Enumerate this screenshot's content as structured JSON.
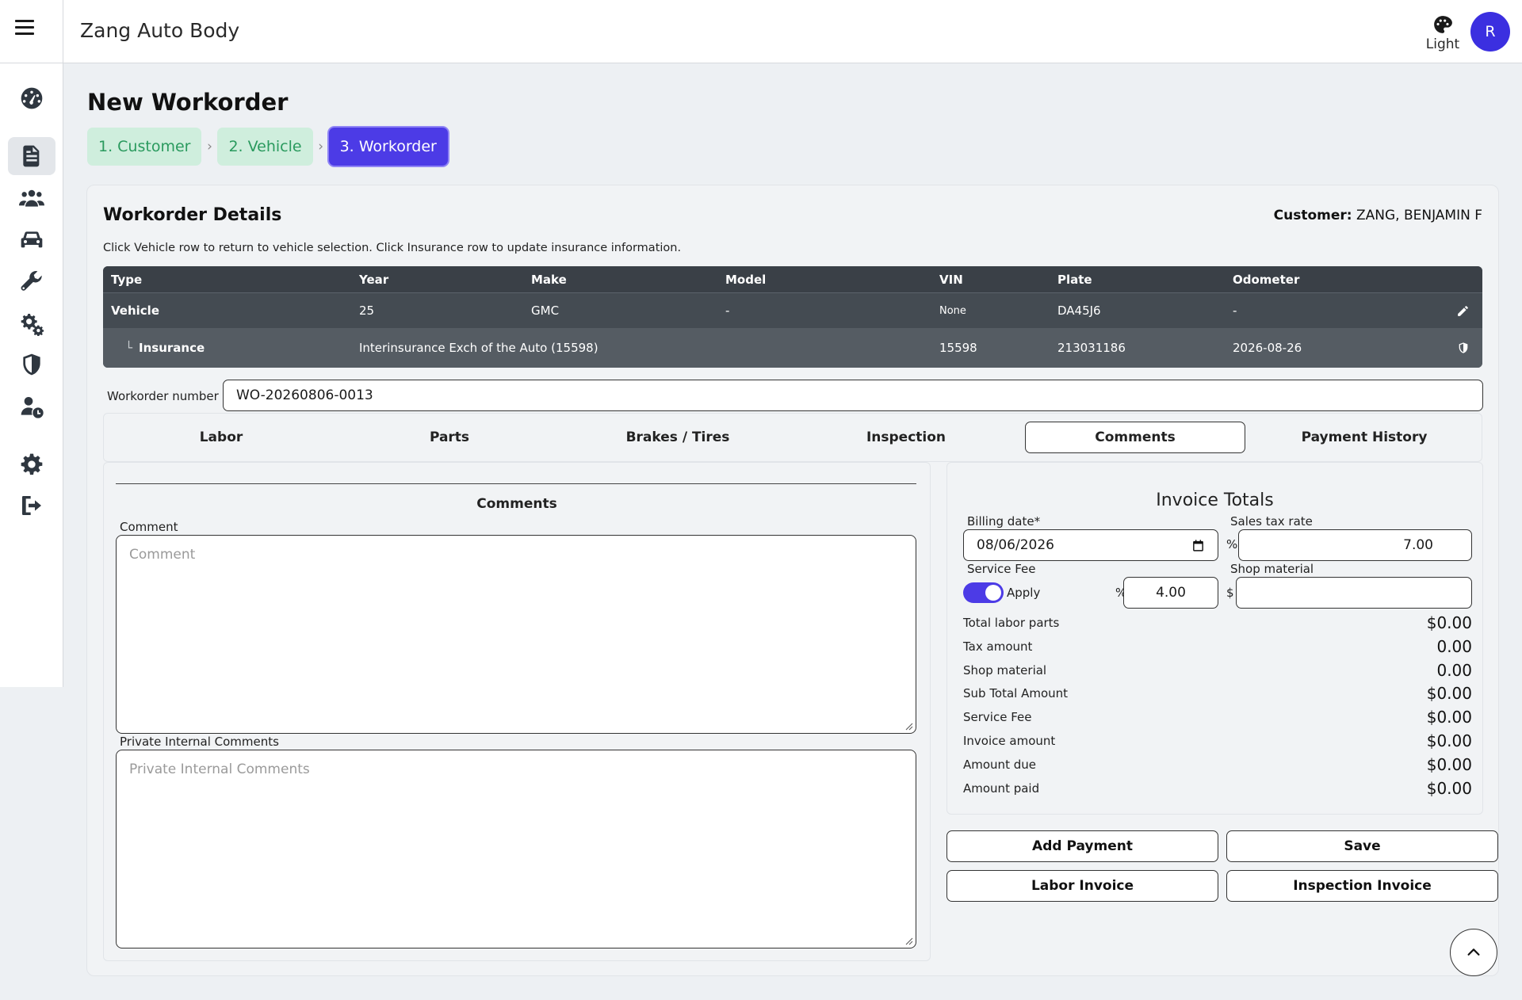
{
  "app": {
    "title": "Zang Auto Body",
    "theme_label": "Light",
    "avatar_initial": "R"
  },
  "sidebar": {
    "items": [
      {
        "icon": "dashboard-icon"
      },
      {
        "icon": "workorder-icon",
        "active": true
      },
      {
        "icon": "customers-icon"
      },
      {
        "icon": "car-icon"
      },
      {
        "icon": "wrench-icon"
      },
      {
        "icon": "gears-icon"
      },
      {
        "icon": "shield-icon"
      },
      {
        "icon": "user-clock-icon"
      },
      {
        "icon": "settings-icon"
      },
      {
        "icon": "logout-icon"
      }
    ]
  },
  "page": {
    "title": "New Workorder",
    "steps": [
      "1. Customer",
      "2. Vehicle",
      "3. Workorder"
    ],
    "current_step": 3
  },
  "details": {
    "title": "Workorder Details",
    "customer_label": "Customer:",
    "customer_name": "ZANG, BENJAMIN F",
    "hint": "Click Vehicle row to return to vehicle selection. Click Insurance row to update insurance information.",
    "table": {
      "headers": [
        "Type",
        "Year",
        "Make",
        "Model",
        "VIN",
        "Plate",
        "Odometer"
      ],
      "vehicle": {
        "type": "Vehicle",
        "year": "25",
        "make": "GMC",
        "model": "-",
        "vin": "None",
        "plate": "DA45J6",
        "odometer": "-"
      },
      "insurance": {
        "prefix": "└",
        "type": "Insurance",
        "company": "Interinsurance Exch of the Auto (15598)",
        "vin_col": "15598",
        "plate_col": "213031186",
        "odometer_col": "2026-08-26"
      }
    }
  },
  "workorder_number": {
    "label": "Workorder number",
    "value": "WO-20260806-0013"
  },
  "tabs": [
    "Labor",
    "Parts",
    "Brakes / Tires",
    "Inspection",
    "Comments",
    "Payment History"
  ],
  "active_tab": "Comments",
  "comments": {
    "title": "Comments",
    "comment_label": "Comment",
    "comment_placeholder": "Comment",
    "private_label": "Private Internal Comments",
    "private_placeholder": "Private Internal Comments"
  },
  "invoice": {
    "title": "Invoice Totals",
    "billing_date_label": "Billing date*",
    "billing_date": "08/06/2026",
    "sales_tax_label": "Sales tax rate",
    "sales_tax_symbol": "%",
    "sales_tax_value": "7.00",
    "service_fee_label": "Service Fee",
    "service_fee_toggle_label": "Apply",
    "service_fee_on": true,
    "service_fee_symbol": "%",
    "service_fee_value": "4.00",
    "shop_material_label": "Shop material",
    "shop_material_symbol": "$",
    "shop_material_value": "",
    "totals": [
      {
        "label": "Total labor parts",
        "value": "$0.00"
      },
      {
        "label": "Tax amount",
        "value": "0.00"
      },
      {
        "label": "Shop material",
        "value": "0.00"
      },
      {
        "label": "Sub Total Amount",
        "value": "$0.00"
      },
      {
        "label": "Service Fee",
        "value": "$0.00"
      },
      {
        "label": "Invoice amount",
        "value": "$0.00"
      },
      {
        "label": "Amount due",
        "value": "$0.00"
      },
      {
        "label": "Amount paid",
        "value": "$0.00"
      }
    ]
  },
  "buttons": {
    "add_payment": "Add Payment",
    "save": "Save",
    "labor_invoice": "Labor Invoice",
    "inspection_invoice": "Inspection Invoice"
  },
  "colors": {
    "accent": "#4c3be6",
    "step_done_bg": "#cfeedd",
    "step_done_text": "#2a9a5e",
    "table_bg": "#444b52"
  }
}
